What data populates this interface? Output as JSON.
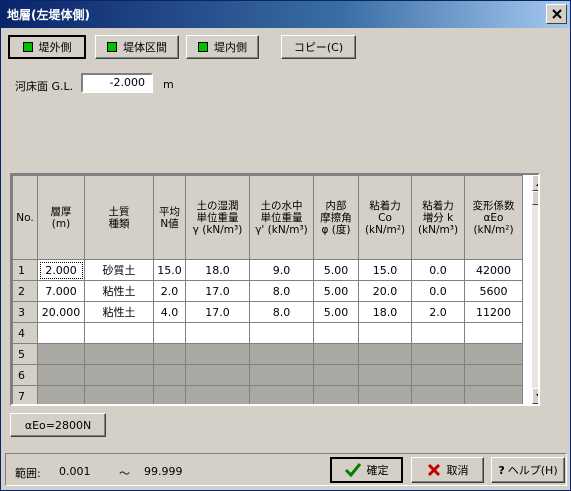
{
  "window": {
    "title": "地層(左堤体側)"
  },
  "tabs": [
    {
      "label": "堤外側",
      "active": true
    },
    {
      "label": "堤体区間",
      "active": false
    },
    {
      "label": "堤内側",
      "active": false
    }
  ],
  "copy_button": "コピー(C)",
  "riverbed": {
    "label": "河床面 G.L.",
    "value": "-2.000",
    "unit": "m"
  },
  "table": {
    "headers": [
      [
        "No."
      ],
      [
        "層厚",
        "(m)"
      ],
      [
        "土質",
        "種類"
      ],
      [
        "平均",
        "N値"
      ],
      [
        "土の湿潤",
        "単位重量",
        "γ (kN/m³)"
      ],
      [
        "土の水中",
        "単位重量",
        "γ' (kN/m³)"
      ],
      [
        "内部",
        "摩擦角",
        "φ (度)"
      ],
      [
        "粘着力",
        "Co",
        "(kN/m²)"
      ],
      [
        "粘着力",
        "増分 k",
        "(kN/m³)"
      ],
      [
        "変形係数",
        "αEo",
        "(kN/m²)"
      ]
    ],
    "rows": [
      [
        "1",
        "2.000",
        "砂質土",
        "15.0",
        "18.0",
        "9.0",
        "5.00",
        "15.0",
        "0.0",
        "42000"
      ],
      [
        "2",
        "7.000",
        "粘性土",
        "2.0",
        "17.0",
        "8.0",
        "5.00",
        "20.0",
        "0.0",
        "5600"
      ],
      [
        "3",
        "20.000",
        "粘性土",
        "4.0",
        "17.0",
        "8.0",
        "5.00",
        "18.0",
        "2.0",
        "11200"
      ],
      [
        "4",
        "",
        "",
        "",
        "",
        "",
        "",
        "",
        "",
        ""
      ],
      [
        "5",
        "",
        "",
        "",
        "",
        "",
        "",
        "",
        "",
        ""
      ],
      [
        "6",
        "",
        "",
        "",
        "",
        "",
        "",
        "",
        "",
        ""
      ],
      [
        "7",
        "",
        "",
        "",
        "",
        "",
        "",
        "",
        "",
        ""
      ]
    ],
    "gray_rows": [
      5,
      6,
      7
    ]
  },
  "aeo_button": "αEo=2800N",
  "status": {
    "label": "範囲:",
    "min": "0.001",
    "sep": "～",
    "max": "99.999"
  },
  "buttons": {
    "ok": "確定",
    "cancel": "取消",
    "help": "ヘルプ(H)"
  },
  "colors": {
    "tab_indicator": "#00c000",
    "ok_check": "#008000",
    "cancel_x": "#c00000",
    "title_bg": "#0a246a"
  }
}
